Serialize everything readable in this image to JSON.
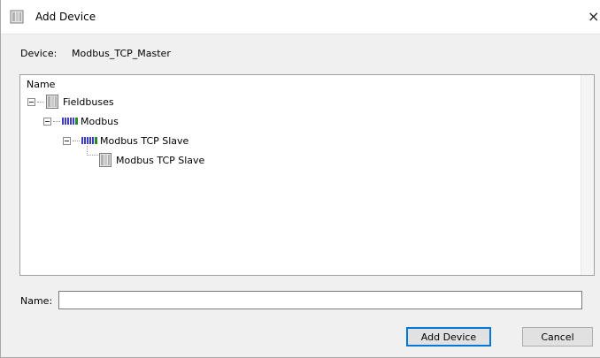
{
  "window": {
    "title": "Add Device",
    "title_icon": "device-module-icon",
    "close_glyph": "×"
  },
  "device": {
    "label": "Device:",
    "value": "Modbus_TCP_Master"
  },
  "tree": {
    "column_header": "Name",
    "items": [
      {
        "label": "Fieldbuses",
        "icon": "device-module-icon",
        "expanded": true
      },
      {
        "label": "Modbus",
        "icon": "bus-icon",
        "expanded": true
      },
      {
        "label": "Modbus TCP Slave",
        "icon": "bus-icon",
        "expanded": true
      },
      {
        "label": "Modbus TCP Slave",
        "icon": "device-module-icon",
        "expanded": false
      }
    ]
  },
  "name_field": {
    "label": "Name:",
    "value": "",
    "placeholder": ""
  },
  "buttons": {
    "add_device": "Add Device",
    "cancel": "Cancel"
  },
  "colors": {
    "window_bg": "#f0f0f0",
    "primary_border": "#0078d7",
    "bus_icon": "#3c3cc8"
  }
}
